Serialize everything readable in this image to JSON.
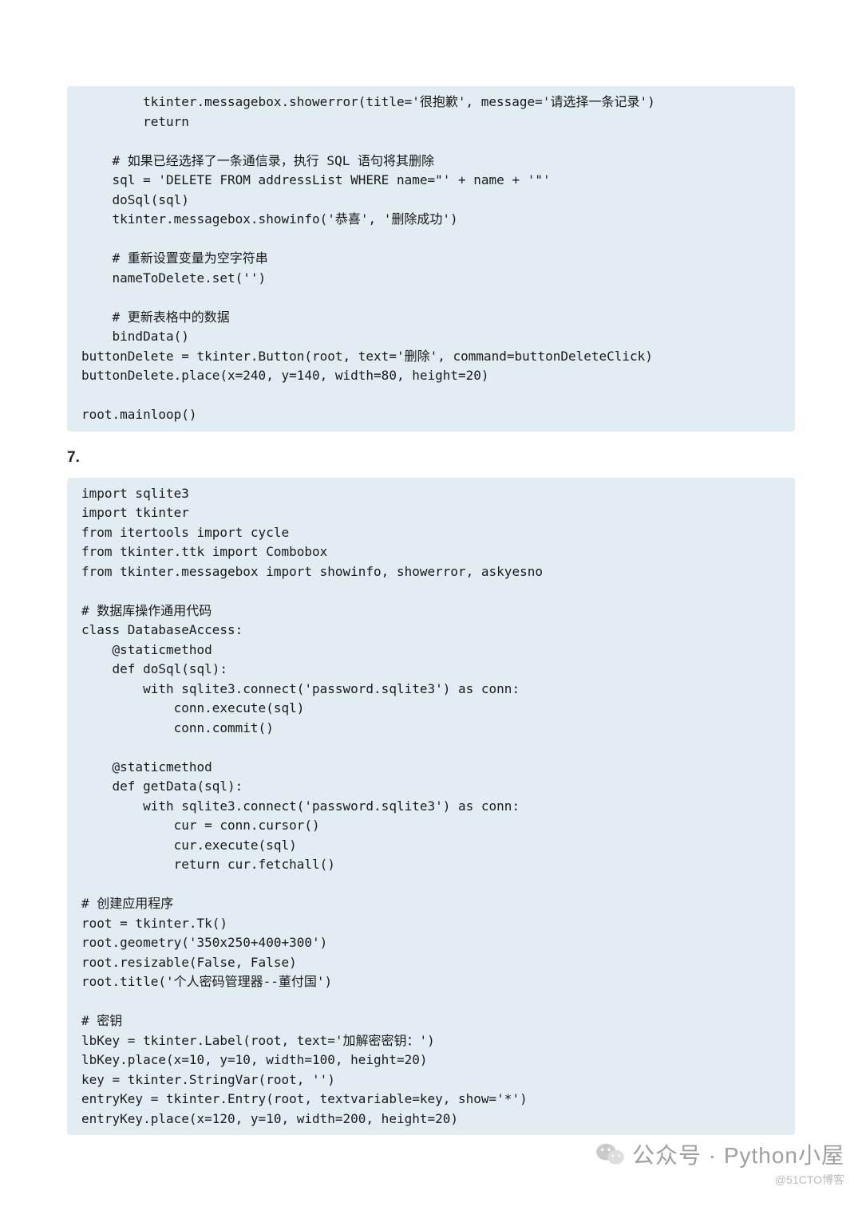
{
  "code_block_1": "        tkinter.messagebox.showerror(title='很抱歉', message='请选择一条记录')\n        return\n\n    # 如果已经选择了一条通信录，执行 SQL 语句将其删除\n    sql = 'DELETE FROM addressList WHERE name=\"' + name + '\"'\n    doSql(sql)\n    tkinter.messagebox.showinfo('恭喜', '删除成功')\n\n    # 重新设置变量为空字符串\n    nameToDelete.set('')\n\n    # 更新表格中的数据\n    bindData()\nbuttonDelete = tkinter.Button(root, text='删除', command=buttonDeleteClick)\nbuttonDelete.place(x=240, y=140, width=80, height=20)\n\nroot.mainloop()",
  "section_number": "7.",
  "code_block_2": "import sqlite3\nimport tkinter\nfrom itertools import cycle\nfrom tkinter.ttk import Combobox\nfrom tkinter.messagebox import showinfo, showerror, askyesno\n\n# 数据库操作通用代码\nclass DatabaseAccess:\n    @staticmethod\n    def doSql(sql):\n        with sqlite3.connect('password.sqlite3') as conn:\n            conn.execute(sql)\n            conn.commit()\n\n    @staticmethod\n    def getData(sql):\n        with sqlite3.connect('password.sqlite3') as conn:\n            cur = conn.cursor()\n            cur.execute(sql)\n            return cur.fetchall()\n\n# 创建应用程序\nroot = tkinter.Tk()\nroot.geometry('350x250+400+300')\nroot.resizable(False, False)\nroot.title('个人密码管理器--董付国')\n\n# 密钥\nlbKey = tkinter.Label(root, text='加解密密钥：')\nlbKey.place(x=10, y=10, width=100, height=20)\nkey = tkinter.StringVar(root, '')\nentryKey = tkinter.Entry(root, textvariable=key, show='*')\nentryKey.place(x=120, y=10, width=200, height=20)",
  "watermark": {
    "main": "公众号 · Python小屋",
    "sub": "@51CTO博客"
  }
}
